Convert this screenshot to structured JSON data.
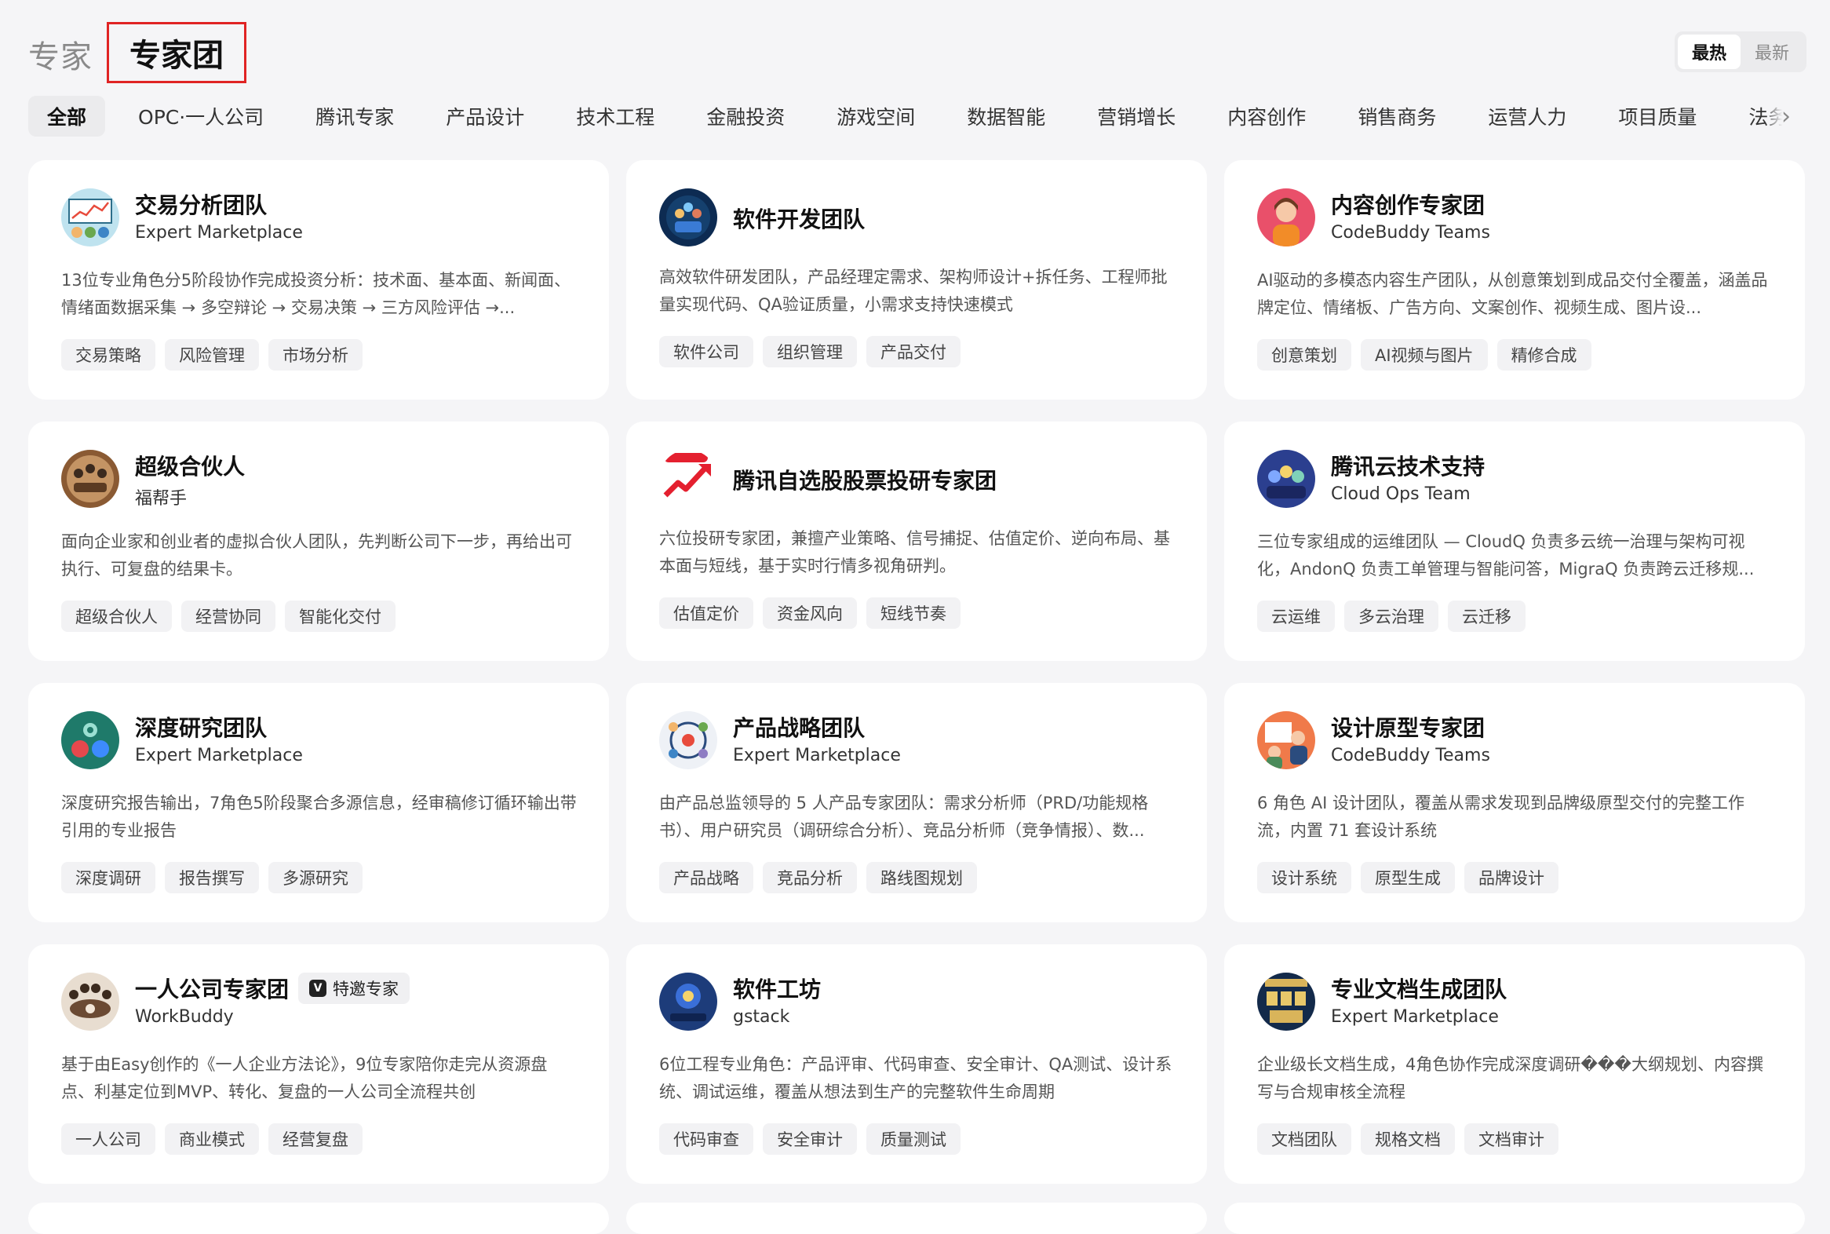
{
  "header": {
    "tab_expert": "专家",
    "tab_team": "专家团",
    "sort": [
      "最热",
      "最新"
    ]
  },
  "categories": [
    "全部",
    "OPC·一人公司",
    "腾讯专家",
    "产品设计",
    "技术工程",
    "金融投资",
    "游戏空间",
    "数据智能",
    "营销增长",
    "内容创作",
    "销售商务",
    "运营人力",
    "项目质量",
    "法务安全"
  ],
  "cards": [
    {
      "title": "交易分析团队",
      "subtitle": "Expert Marketplace",
      "desc": "13位专业角色分5阶段协作完成投资分析：技术面、基本面、新闻面、情绪面数据采集 → 多空辩论 → 交易决策 → 三方风险评估 →...",
      "tags": [
        "交易策略",
        "风险管理",
        "市场分析"
      ]
    },
    {
      "title": "软件开发团队",
      "subtitle": "",
      "desc": "高效软件研发团队，产品经理定需求、架构师设计+拆任务、工程师批量实现代码、QA验证质量，小需求支持快速模式",
      "tags": [
        "软件公司",
        "组织管理",
        "产品交付"
      ]
    },
    {
      "title": "内容创作专家团",
      "subtitle": "CodeBuddy Teams",
      "desc": "AI驱动的多模态内容生产团队，从创意策划到成品交付全覆盖，涵盖品牌定位、情绪板、广告方向、文案创作、视频生成、图片设...",
      "tags": [
        "创意策划",
        "AI视频与图片",
        "精修合成"
      ]
    },
    {
      "title": "超级合伙人",
      "subtitle": "福帮手",
      "desc": "面向企业家和创业者的虚拟合伙人团队，先判断公司下一步，再给出可执行、可复盘的结果卡。",
      "tags": [
        "超级合伙人",
        "经营协同",
        "智能化交付"
      ]
    },
    {
      "title": "腾讯自选股股票投研专家团",
      "subtitle": "",
      "desc": "六位投研专家团，兼擅产业策略、信号捕捉、估值定价、逆向布局、基本面与短线，基于实时行情多视角研判。",
      "tags": [
        "估值定价",
        "资金风向",
        "短线节奏"
      ]
    },
    {
      "title": "腾讯云技术支持",
      "subtitle": "Cloud Ops Team",
      "desc": "三位专家组成的运维团队 — CloudQ 负责多云统一治理与架构可视化，AndonQ 负责工单管理与智能问答，MigraQ 负责跨云迁移规...",
      "tags": [
        "云运维",
        "多云治理",
        "云迁移"
      ]
    },
    {
      "title": "深度研究团队",
      "subtitle": "Expert Marketplace",
      "desc": "深度研究报告输出，7角色5阶段聚合多源信息，经审稿修订循环输出带引用的专业报告",
      "tags": [
        "深度调研",
        "报告撰写",
        "多源研究"
      ]
    },
    {
      "title": "产品战略团队",
      "subtitle": "Expert Marketplace",
      "desc": "由产品总监领导的 5 人产品专家团队：需求分析师（PRD/功能规格书）、用户研究员（调研综合分析）、竞品分析师（竞争情报）、数...",
      "tags": [
        "产品战略",
        "竞品分析",
        "路线图规划"
      ]
    },
    {
      "title": "设计原型专家团",
      "subtitle": "CodeBuddy Teams",
      "desc": "6 角色 AI 设计团队，覆盖从需求发现到品牌级原型交付的完整工作流，内置 71 套设计系统",
      "tags": [
        "设计系统",
        "原型生成",
        "品牌设计"
      ]
    },
    {
      "title": "一人公司专家团",
      "subtitle": "WorkBuddy",
      "badge": "特邀专家",
      "desc": "基于由Easy创作的《一人企业方法论》，9位专家陪你走完从资源盘点、利基定位到MVP、转化、复盘的一人公司全流程共创",
      "tags": [
        "一人公司",
        "商业模式",
        "经营复盘"
      ]
    },
    {
      "title": "软件工坊",
      "subtitle": "gstack",
      "desc": "6位工程专业角色：产品评审、代码审查、安全审计、QA测试、设计系统、调试运维，覆盖从想法到生产的完整软件生命周期",
      "tags": [
        "代码审查",
        "安全审计",
        "质量测试"
      ]
    },
    {
      "title": "专业文档生成团队",
      "subtitle": "Expert Marketplace",
      "desc": "企业级长文档生成，4角色协作完成深度调研���大纲规划、内容撰写与合规审核全流程",
      "tags": [
        "文档团队",
        "规格文档",
        "文档审计"
      ]
    }
  ]
}
